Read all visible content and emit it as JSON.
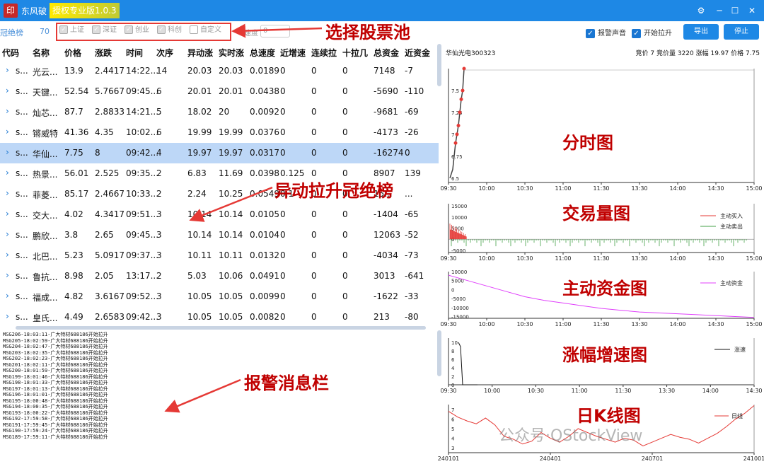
{
  "titlebar": {
    "logo": "印",
    "app_name": "东风破",
    "version": "授权专业版1.0.3"
  },
  "toolbar": {
    "rank_tab": "冠绝榜",
    "rank_count": "70",
    "pools": [
      {
        "label": "上证",
        "checked": true
      },
      {
        "label": "深证",
        "checked": true
      },
      {
        "label": "创业",
        "checked": true
      },
      {
        "label": "科创",
        "checked": true
      },
      {
        "label": "自定义",
        "checked": false
      }
    ],
    "speed_label": "速度",
    "speed_value": "0",
    "alarm_sound": "报警声音",
    "start_pull": "开始拉升",
    "export_btn": "导出",
    "stop_btn": "停止"
  },
  "table": {
    "columns": [
      "代码",
      "名称",
      "价格",
      "涨跌",
      "时间",
      "次序",
      "异动涨",
      "实时涨",
      "总速度",
      "近增速",
      "连续拉",
      "十拉几",
      "总资金",
      "近资金"
    ],
    "rows": [
      [
        "s...",
        "光云...",
        "13.9",
        "2.4417",
        "14:22...",
        "14",
        "20.03",
        "20.03",
        "0.0189",
        "0",
        "0",
        "0",
        "7148",
        "-7"
      ],
      [
        "s...",
        "天键...",
        "52.54",
        "5.7667",
        "09:45...",
        "6",
        "20.01",
        "20.01",
        "0.0438",
        "0",
        "0",
        "0",
        "-5690",
        "-110"
      ],
      [
        "s...",
        "灿芯...",
        "87.7",
        "2.8833",
        "14:21...",
        "5",
        "18.02",
        "20",
        "0.0092",
        "0",
        "0",
        "0",
        "-9681",
        "-69"
      ],
      [
        "s...",
        "锵威特",
        "41.36",
        "4.35",
        "10:02...",
        "6",
        "19.99",
        "19.99",
        "0.0376",
        "0",
        "0",
        "0",
        "-4173",
        "-26"
      ],
      [
        "s...",
        "华仙...",
        "7.75",
        "8",
        "09:42...",
        "4",
        "19.97",
        "19.97",
        "0.0317",
        "0",
        "0",
        "0",
        "-16274",
        "0"
      ],
      [
        "s...",
        "热景...",
        "56.01",
        "2.525",
        "09:35...",
        "2",
        "6.83",
        "11.69",
        "0.0398",
        "0.125",
        "0",
        "0",
        "8907",
        "139"
      ],
      [
        "s...",
        "菲菱...",
        "85.17",
        "2.4667",
        "10:33...",
        "2",
        "2.24",
        "10.25",
        "0.0549",
        "0.1",
        "0",
        "0",
        "15...",
        "..."
      ],
      [
        "s...",
        "交大...",
        "4.02",
        "4.3417",
        "09:51...",
        "3",
        "10.14",
        "10.14",
        "0.0105",
        "0",
        "0",
        "0",
        "-1404",
        "-65"
      ],
      [
        "s...",
        "鹏欣...",
        "3.8",
        "2.65",
        "09:45...",
        "3",
        "10.14",
        "10.14",
        "0.0104",
        "0",
        "0",
        "0",
        "12063",
        "-52"
      ],
      [
        "s...",
        "北巴...",
        "5.23",
        "5.0917",
        "09:37...",
        "3",
        "10.11",
        "10.11",
        "0.0132",
        "0",
        "0",
        "0",
        "-4034",
        "-73"
      ],
      [
        "s...",
        "鲁抗...",
        "8.98",
        "2.05",
        "13:17...",
        "2",
        "5.03",
        "10.06",
        "0.0491",
        "0",
        "0",
        "0",
        "3013",
        "-641"
      ],
      [
        "s...",
        "福成...",
        "4.82",
        "3.6167",
        "09:52...",
        "3",
        "10.05",
        "10.05",
        "0.0099",
        "0",
        "0",
        "0",
        "-1622",
        "-33"
      ],
      [
        "s...",
        "皇氏...",
        "4.49",
        "2.6583",
        "09:42...",
        "3",
        "10.05",
        "10.05",
        "0.0082",
        "0",
        "0",
        "0",
        "213",
        "-80"
      ]
    ],
    "selected_row": 4
  },
  "log": [
    "MSG206-18:03:11-广大特材688186开始拉升",
    "MSG205-18:02:59-广大特材688186开始拉升",
    "MSG204-18:02:47-广大特材688186开始拉升",
    "MSG203-18:02:35-广大特材688186开始拉升",
    "MSG202-18:02:23-广大特材688186开始拉升",
    "MSG201-18:02:11-广大特材688186开始拉升",
    "MSG200-18:01:59-广大特材688186开始拉升",
    "MSG199-18:01:46-广大特材688186开始拉升",
    "MSG198-18:01:33-广大特材688186开始拉升",
    "MSG197-18:01:13-广大特材688186开始拉升",
    "MSG196-18:01:01-广大特材688186开始拉升",
    "MSG195-18:00:48-广大特材688186开始拉升",
    "MSG194-18:00:35-广大特材688186开始拉升",
    "MSG193-18:00:22-广大特材688186开始拉升",
    "MSG192-17:59:58-广大特材688186开始拉升",
    "MSG191-17:59:45-广大特材688186开始拉升",
    "MSG190-17:59:24-广大特材688186开始拉升",
    "MSG189-17:59:11-广大特材688186开始拉升"
  ],
  "right_header": {
    "stock": "华仙光电300323",
    "quote": "竞价  7  竞价量  3220  涨幅  19.97  价格  7.75"
  },
  "annotations": {
    "pool": "选择股票池",
    "rank": "异动拉升冠绝榜",
    "log": "报警消息栏",
    "intraday": "分时图",
    "volume": "交易量图",
    "capital": "主动资金图",
    "speed": "涨幅增速图",
    "kline": "日K线图"
  },
  "watermark": "公众号·QStockView",
  "colors": {
    "titlebar": "#1e88e5",
    "selected": "#bdd7f7",
    "annotation": "#c00000"
  },
  "chart_data": [
    {
      "type": "line",
      "x_ticks": [
        "09:30",
        "10:00",
        "10:30",
        "11:00",
        "11:30",
        "13:30",
        "14:00",
        "14:30",
        "15:00"
      ],
      "y_ticks": [
        "6.5",
        "6.75",
        "7",
        "7.25",
        "7.5"
      ],
      "ylim": [
        6.45,
        7.75
      ],
      "series": [
        {
          "values": [
            6.5,
            6.55,
            6.6,
            6.75,
            6.9,
            7.0,
            7.1,
            7.25,
            7.4,
            7.5,
            7.75
          ]
        }
      ]
    },
    {
      "type": "bar",
      "x_ticks": [
        "09:30",
        "10:00",
        "10:30",
        "11:00",
        "11:30",
        "13:30",
        "14:00",
        "14:30",
        "15:00"
      ],
      "y_ticks": [
        "15000",
        "10000",
        "5000",
        "0",
        "-5000"
      ],
      "ylim": [
        -6000,
        16000
      ],
      "series": [
        {
          "name": "主动买入"
        },
        {
          "name": "主动卖出"
        }
      ]
    },
    {
      "type": "line",
      "x_ticks": [
        "09:30",
        "10:00",
        "10:30",
        "11:00",
        "11:30",
        "13:30",
        "14:00",
        "14:30",
        "15:00"
      ],
      "y_ticks": [
        "10000",
        "5000",
        "0",
        "-5000",
        "-10000",
        "-15000"
      ],
      "ylim": [
        -16000,
        10000
      ],
      "series": [
        {
          "name": "主动资金",
          "values": [
            8000,
            5000,
            2000,
            -1000,
            -4000,
            -6000,
            -7500,
            -9000,
            -10500,
            -11500,
            -12500,
            -13000,
            -13500,
            -14000,
            -14500,
            -15000,
            -15500
          ]
        }
      ]
    },
    {
      "type": "line",
      "x_ticks": [
        "09:30",
        "10:00",
        "10:30",
        "11:00",
        "11:30",
        "13:30",
        "14:00",
        "14:30"
      ],
      "y_ticks": [
        "10",
        "8",
        "6",
        "4",
        "2",
        "0"
      ],
      "ylim": [
        0,
        11
      ],
      "series": [
        {
          "name": "涨速",
          "values": [
            10,
            9,
            0,
            0,
            0,
            0,
            0,
            0,
            0,
            0
          ]
        }
      ]
    },
    {
      "type": "line",
      "x_ticks": [
        "240101",
        "240401",
        "240701",
        "241001"
      ],
      "y_ticks": [
        "7",
        "6",
        "5",
        "4",
        "3"
      ],
      "ylim": [
        2.5,
        7.5
      ],
      "series": [
        {
          "name": "日线",
          "values": [
            6.8,
            6.2,
            5.8,
            5.5,
            6.1,
            5.4,
            4.2,
            3.9,
            3.4,
            3.7,
            4.6,
            4.0,
            3.6,
            4.2,
            5.0,
            4.6,
            4.2,
            3.9,
            3.6,
            4.0,
            3.8,
            3.2,
            3.6,
            4.0,
            4.4,
            4.1,
            3.9,
            3.5,
            4.0,
            4.5,
            5.2,
            6.0,
            6.6,
            7.4
          ]
        }
      ]
    }
  ]
}
